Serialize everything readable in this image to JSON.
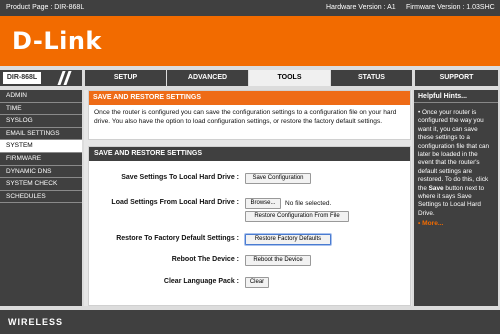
{
  "topbar": {
    "product": "Product Page : DIR-868L",
    "hardware": "Hardware Version : A1",
    "firmware": "Firmware Version : 1.03SHC"
  },
  "brand": {
    "logo_text": "D-Link"
  },
  "model": "DIR-868L",
  "nav": [
    {
      "label": "SETUP"
    },
    {
      "label": "ADVANCED"
    },
    {
      "label": "TOOLS"
    },
    {
      "label": "STATUS"
    },
    {
      "label": "SUPPORT"
    }
  ],
  "sidebar": [
    {
      "label": "ADMIN"
    },
    {
      "label": "TIME"
    },
    {
      "label": "SYSLOG"
    },
    {
      "label": "EMAIL SETTINGS"
    },
    {
      "label": "SYSTEM"
    },
    {
      "label": "FIRMWARE"
    },
    {
      "label": "DYNAMIC DNS"
    },
    {
      "label": "SYSTEM CHECK"
    },
    {
      "label": "SCHEDULES"
    }
  ],
  "intro": {
    "title": "SAVE AND RESTORE SETTINGS",
    "text": "Once the router is configured you can save the configuration settings to a configuration file on your hard drive. You also have the option to load configuration settings, or restore the factory default settings."
  },
  "section": {
    "title": "SAVE AND RESTORE SETTINGS",
    "save_label": "Save Settings To Local Hard Drive :",
    "save_button": "Save Configuration",
    "load_label": "Load Settings From Local Hard Drive :",
    "browse_button": "Browse...",
    "no_file": "No file selected.",
    "restore_config_button": "Restore Configuration From File",
    "factory_label": "Restore To Factory Default Settings :",
    "factory_button": "Restore Factory Defaults",
    "reboot_label": "Reboot The Device :",
    "reboot_button": "Reboot the Device",
    "clear_label": "Clear Language Pack :",
    "clear_button": "Clear"
  },
  "hints": {
    "title": "Helpful Hints...",
    "text_1": "Once your router is configured the way you want it, you can save these settings to a configuration file that can later be loaded in the event that the router's default settings are restored. To do this, click the ",
    "bold_word": "Save",
    "text_2": " button next to where it says Save Settings to Local Hard Drive.",
    "more": "More..."
  },
  "footer": {
    "label": "WIRELESS"
  }
}
